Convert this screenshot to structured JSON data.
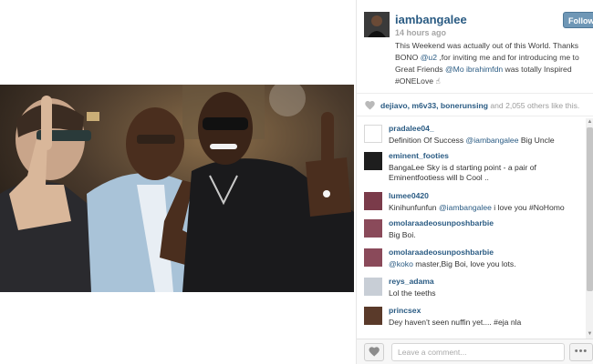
{
  "post": {
    "username": "iambangalee",
    "timestamp": "14 hours ago",
    "follow_label": "Follow",
    "caption": {
      "part1": "This Weekend was actually out of this World. Thanks BONO ",
      "mention1": "@u2",
      "part2": " ,for inviting me and for introducing me to Great Friends ",
      "mention2": "@Mo",
      "mention3": "ibrahimfdn",
      "part3": " was totally Inspired #ONELove ",
      "emoji": "☝"
    }
  },
  "likes": {
    "names": "dejiavo, m6v33, bonerunsing",
    "rest": " and 2,055 others like this."
  },
  "comments": [
    {
      "user": "pradalee04_",
      "text": "Definition Of Success ",
      "mention": "@iambangalee",
      "text2": " Big Uncle",
      "avatar_color": "#ffffff"
    },
    {
      "user": "eminent_footies",
      "text": "BangaLee Sky is d starting point - a pair of Eminentfootiess will b Cool ..",
      "mention": "",
      "text2": "",
      "avatar_color": "#1e1e1e"
    },
    {
      "user": "lumee0420",
      "text": "Kinihunfunfun ",
      "mention": "@iambangalee",
      "text2": " i love you #NoHomo",
      "avatar_color": "#7a3b4a"
    },
    {
      "user": "omolaraadeosunposhbarbie",
      "text": "Big Boi.",
      "mention": "",
      "text2": "",
      "avatar_color": "#8a4a5a"
    },
    {
      "user": "omolaraadeosunposhbarbie",
      "text": "",
      "mention": "@koko",
      "text2": " master,Big Boi, love you lots.",
      "avatar_color": "#8a4a5a"
    },
    {
      "user": "reys_adama",
      "text": "Lol the teeths",
      "mention": "",
      "text2": "",
      "avatar_color": "#c8ced6"
    },
    {
      "user": "princsex",
      "text": "Dey haven't seen nuffin yet.... #eja nla",
      "mention": "",
      "text2": "",
      "avatar_color": "#5a3a2a"
    }
  ],
  "footer": {
    "comment_placeholder": "Leave a comment...",
    "more_label": "•••"
  },
  "icons": {
    "like": "heart-icon",
    "more": "ellipsis-icon",
    "likes_heart": "heart-icon"
  },
  "colors": {
    "link": "#2a5b83",
    "follow_bg": "#6f97b6",
    "muted": "#9b9b9b"
  }
}
